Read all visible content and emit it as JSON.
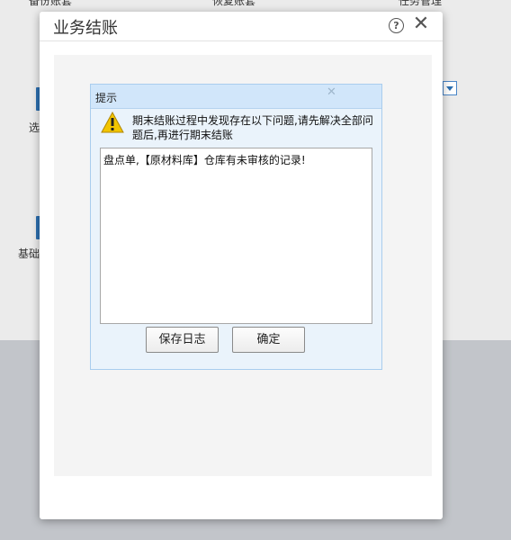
{
  "background": {
    "top_labels": [
      "备份账套",
      "恢复账套",
      "任务管理"
    ],
    "side_labels": [
      "选",
      "基础"
    ]
  },
  "dialog": {
    "title": "业务结账",
    "help_icon": "help-icon",
    "close_icon": "close-icon",
    "help_glyph": "?",
    "close_glyph": "✕"
  },
  "prompt": {
    "title": "提示",
    "close_glyph": "✕",
    "warning_icon": "warning-icon",
    "message": "期末结账过程中发现存在以下问题,请先解决全部问题后,再进行期末结账",
    "log_lines": [
      "盘点单,【原材料库】仓库有未审核的记录!"
    ],
    "buttons": {
      "save_log": "保存日志",
      "ok": "确定"
    }
  },
  "colors": {
    "prompt_bg": "#eaf3fb",
    "prompt_title_bg": "#d1e6fa",
    "warning": "#f2c500"
  }
}
